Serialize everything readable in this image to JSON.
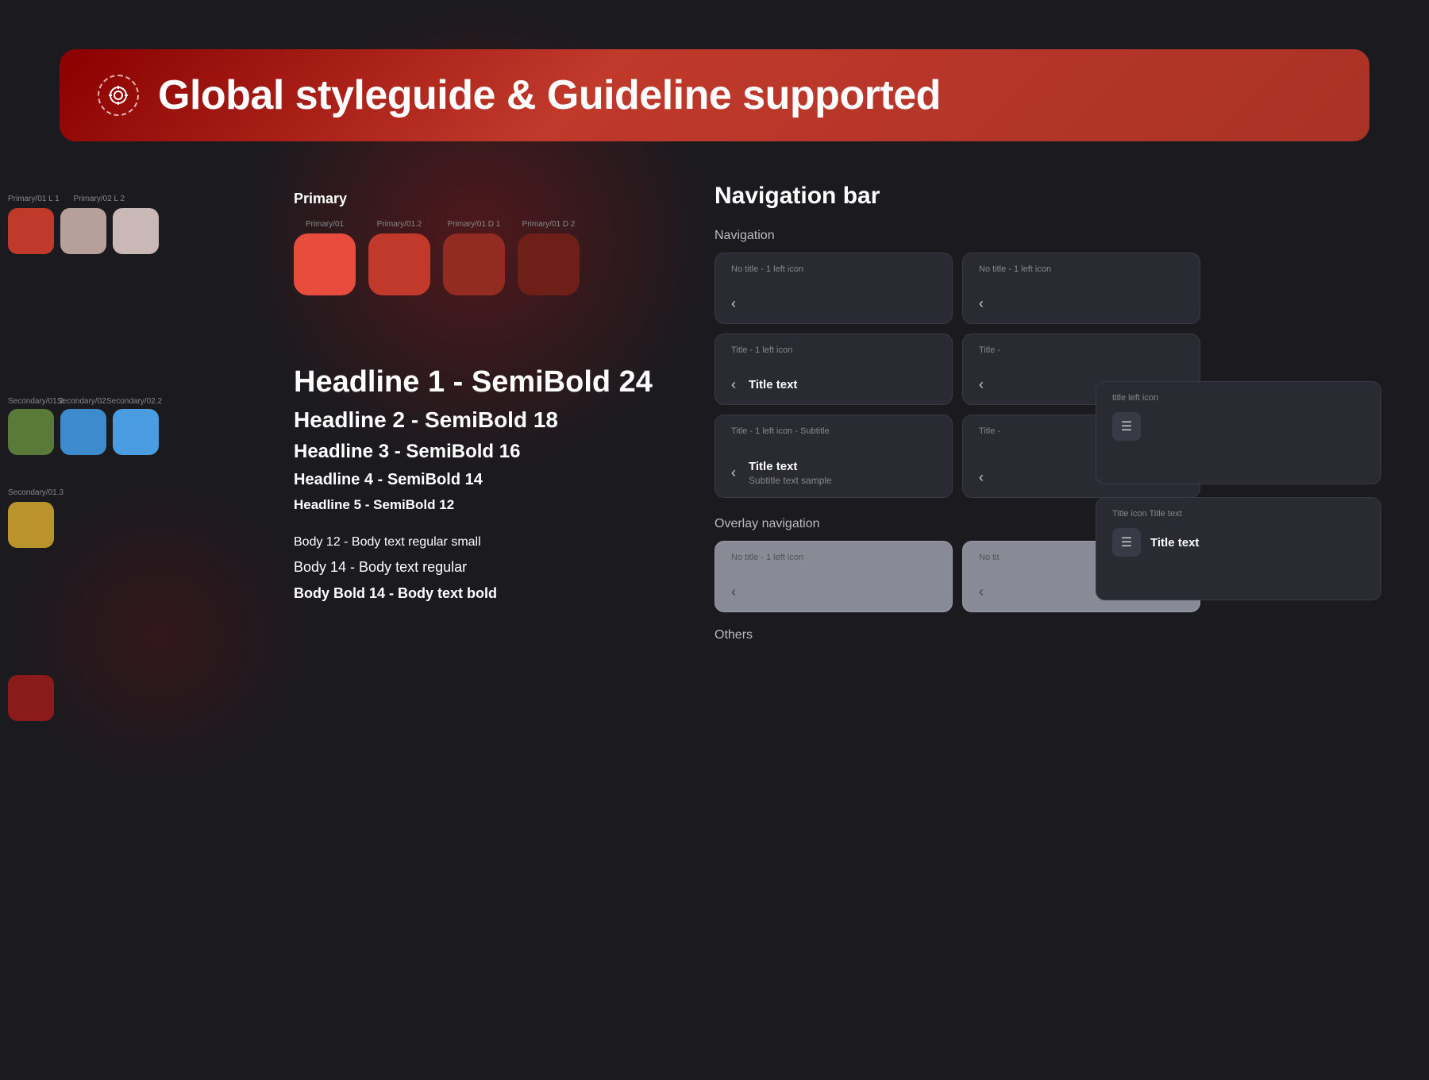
{
  "header": {
    "title": "Global styleguide & Guideline supported",
    "icon_label": "target-icon"
  },
  "left_swatches": {
    "group1": {
      "labels": [
        "",
        "Primary/01 L 1",
        "Primary/02 L 2"
      ],
      "colors": [
        "#c0392b",
        "#b8a09a",
        "#c9b8b5"
      ]
    },
    "group2": {
      "labels": [
        "Secondary/01.2",
        "Secondary/02",
        "Secondary/02.2"
      ],
      "colors": [
        "#5a7a3a",
        "#3d8bcd",
        "#4a9de0"
      ]
    },
    "group3": {
      "labels": [
        "Secondary/01.3"
      ],
      "colors": [
        "#b8942a"
      ]
    }
  },
  "primary_section": {
    "title": "Primary",
    "swatches": [
      {
        "label": "Primary/01",
        "color": "#e74c3c"
      },
      {
        "label": "Primary/01.2",
        "color": "#c0392b"
      },
      {
        "label": "Primary/01 D 1",
        "color": "#922b21"
      },
      {
        "label": "Primary/01 D 2",
        "color": "#6e2018"
      }
    ]
  },
  "typography": {
    "headline1": "Headline 1 - SemiBold 24",
    "headline2": "Headline 2 - SemiBold 18",
    "headline3": "Headline 3 - SemiBold 16",
    "headline4": "Headline 4 - SemiBold 14",
    "headline5": "Headline 5 - SemiBold 12",
    "body_small": "Body 12 - Body text regular small",
    "body_regular": "Body 14 - Body text regular",
    "body_bold": "Body Bold 14 - Body text bold"
  },
  "navigation_bar": {
    "section_title": "Navigation bar",
    "navigation_label": "Navigation",
    "cards": [
      {
        "label": "No title - 1 left icon",
        "icon": "‹",
        "title_text": "",
        "subtitle": ""
      },
      {
        "label": "No title - 1 left icon",
        "icon": "‹",
        "title_text": "",
        "subtitle": ""
      },
      {
        "label": "Title - 1 left icon",
        "icon": "‹",
        "title_text": "Title text",
        "subtitle": ""
      },
      {
        "label": "Title -",
        "icon": "‹",
        "title_text": "",
        "subtitle": ""
      },
      {
        "label": "Title - 1 left icon - Subtitle",
        "icon": "‹",
        "title_text": "Title text",
        "subtitle": "Subtitle text sample"
      },
      {
        "label": "Title -",
        "icon": "‹",
        "title_text": "",
        "subtitle": ""
      }
    ],
    "overlay_label": "Overlay navigation",
    "overlay_cards": [
      {
        "label": "No title - 1 left icon",
        "icon": "‹"
      },
      {
        "label": "No tit",
        "icon": "‹"
      }
    ],
    "others_label": "Others"
  },
  "right_panel": {
    "card1_label": "title left icon",
    "card1_icon": "☰",
    "card1_text": "",
    "card2_label": "Title icon Title text",
    "card2_icon": "☰",
    "card2_text": "Title text"
  }
}
